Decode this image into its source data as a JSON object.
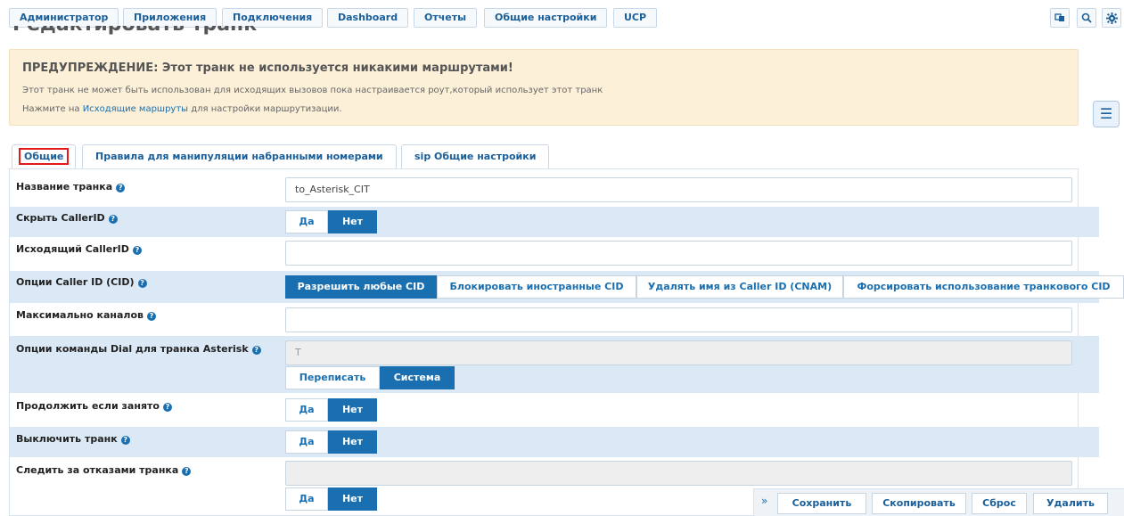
{
  "nav": {
    "items": [
      "Администратор",
      "Приложения",
      "Подключения",
      "Dashboard",
      "Отчеты",
      "Общие настройки",
      "UCP"
    ],
    "icons": [
      "language-icon",
      "search-icon",
      "gear-icon"
    ]
  },
  "page": {
    "title": "Редактировать транк"
  },
  "warning": {
    "title": "ПРЕДУПРЕЖДЕНИЕ: Этот транк не используется никакими маршрутами!",
    "line1": "Этот транк не может быть использован для исходящих вызовов пока настраивается роут,который использует этот транк",
    "line2_prefix": "Нажмите на ",
    "line2_link": "Исходящие маршруты",
    "line2_suffix": " для настройки маршрутизации."
  },
  "tabs": [
    "Общие",
    "Правила для манипуляции набранными номерами",
    "sip Общие настройки"
  ],
  "fields": {
    "trunk_name": {
      "label": "Название транка",
      "value": "to_Asterisk_CIT"
    },
    "hide_callerid": {
      "label": "Скрыть CallerID",
      "yes": "Да",
      "no": "Нет",
      "selected": "Нет"
    },
    "outbound_callerid": {
      "label": "Исходящий CallerID",
      "value": ""
    },
    "cid_options": {
      "label": "Опции Caller ID (CID)",
      "options": [
        "Разрешить любые CID",
        "Блокировать иностранные CID",
        "Удалять имя из Caller ID (CNAM)",
        "Форсировать использование транкового CID"
      ],
      "selected": "Разрешить любые CID"
    },
    "max_channels": {
      "label": "Максимально каналов",
      "value": ""
    },
    "dial_options": {
      "label": "Опции команды Dial для транка Asterisk",
      "value": "T",
      "override": "Переписать",
      "system": "Система",
      "selected": "Система"
    },
    "continue_busy": {
      "label": "Продолжить если занято",
      "yes": "Да",
      "no": "Нет",
      "selected": "Нет"
    },
    "disable_trunk": {
      "label": "Выключить транк",
      "yes": "Да",
      "no": "Нет",
      "selected": "Нет"
    },
    "monitor_failures": {
      "label": "Следить за отказами транка",
      "value": "",
      "yes": "Да",
      "no": "Нет",
      "selected": "Нет"
    }
  },
  "actions": {
    "chevron": "»",
    "save": "Сохранить",
    "duplicate": "Скопировать",
    "reset": "Сброс",
    "delete": "Удалить"
  }
}
